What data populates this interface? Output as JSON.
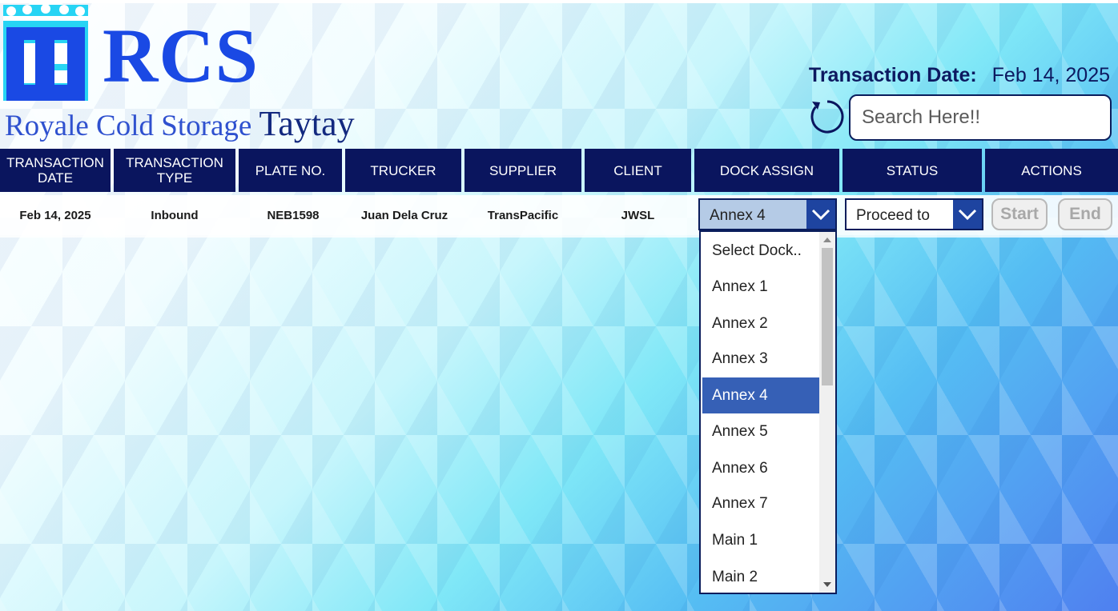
{
  "brand": {
    "logo_text": "RCS",
    "subtitle": "Royale Cold Storage",
    "branch": "Taytay",
    "colors": {
      "primary": "#1a49e4",
      "navy": "#0a155e",
      "dropdown_selected": "#3660b6"
    }
  },
  "header": {
    "date_label": "Transaction Date:",
    "date_value": "Feb 14, 2025",
    "refresh_icon": "refresh-icon",
    "search_placeholder": "Search Here!!"
  },
  "table": {
    "columns": [
      "TRANSACTION DATE",
      "TRANSACTION TYPE",
      "PLATE NO.",
      "TRUCKER",
      "SUPPLIER",
      "CLIENT",
      "DOCK ASSIGN",
      "STATUS",
      "ACTIONS"
    ],
    "rows": [
      {
        "date": "Feb 14, 2025",
        "type": "Inbound",
        "plate": "NEB1598",
        "trucker": "Juan Dela Cruz",
        "supplier": "TransPacific",
        "client": "JWSL",
        "dock": "Annex 4",
        "status": "Proceed to",
        "start_label": "Start",
        "end_label": "End"
      }
    ]
  },
  "dock_dropdown": {
    "options": [
      "Select Dock..",
      "Annex 1",
      "Annex 2",
      "Annex 3",
      "Annex 4",
      "Annex 5",
      "Annex 6",
      "Annex 7",
      "Main 1",
      "Main 2"
    ],
    "selected": "Annex 4"
  }
}
